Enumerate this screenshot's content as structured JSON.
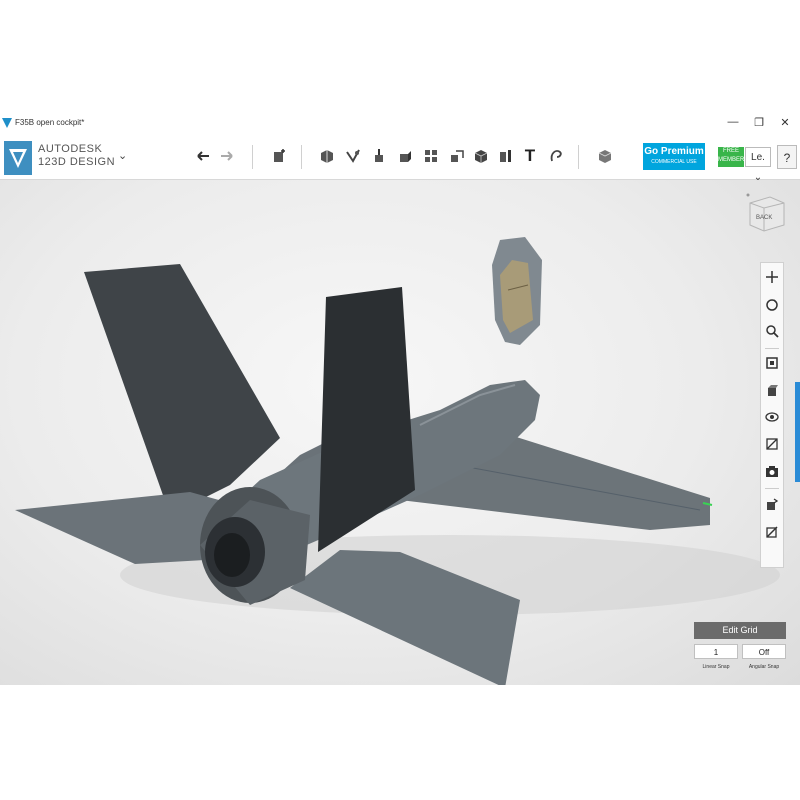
{
  "window": {
    "title": "F35B open cockpit*",
    "minimize": "—",
    "maximize": "❐",
    "close": "✕"
  },
  "brand": {
    "line1": "AUTODESK",
    "line2": "123D DESIGN",
    "menu_icon": "chevron-down-icon"
  },
  "toolbar": {
    "undo_icon": "undo-icon",
    "redo_icon": "redo-icon",
    "tools": [
      "transform-icon",
      "primitives-icon",
      "sketch-icon",
      "construct-icon",
      "modify-icon",
      "pattern-icon",
      "grouping-icon",
      "combine-icon",
      "measure-icon",
      "text-icon",
      "snap-icon",
      "material-icon"
    ],
    "text_tool_label": "T"
  },
  "premium": {
    "label": "Go Premium",
    "sublabel": "COMMERCIAL USE"
  },
  "account": {
    "badge": "FREE MEMBER",
    "user": "Le.",
    "help": "?"
  },
  "viewcube": {
    "label": "BACK"
  },
  "nav_tools": [
    "pan-icon",
    "orbit-icon",
    "zoom-icon",
    "fit-icon",
    "view-icon",
    "visibility-icon",
    "materials-icon",
    "screenshot-icon",
    "show-icon",
    "hide-icon"
  ],
  "grid": {
    "edit_label": "Edit Grid",
    "linear_value": "1",
    "angular_value": "Off",
    "linear_label": "Linear Snap",
    "angular_label": "Angular Snap"
  },
  "colors": {
    "accent": "#00a5de",
    "free_badge": "#39b54a",
    "model": "#6a7379",
    "model_dark": "#34383c"
  }
}
